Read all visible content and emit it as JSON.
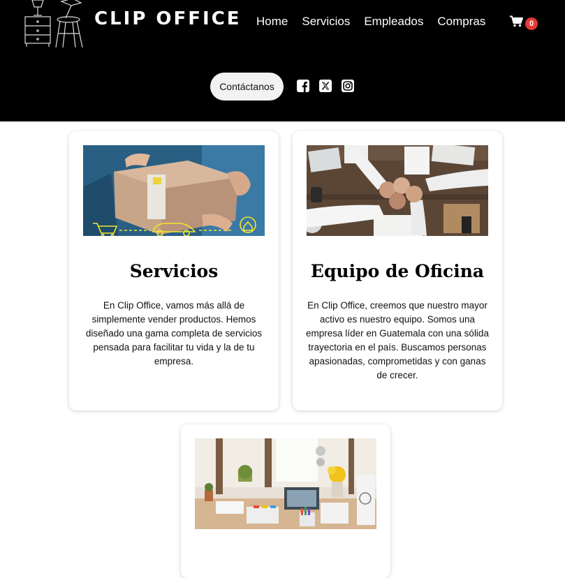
{
  "brand": {
    "name": "CLIP OFFICE"
  },
  "nav": {
    "items": [
      {
        "label": "Home"
      },
      {
        "label": "Servicios"
      },
      {
        "label": "Empleados"
      },
      {
        "label": "Compras"
      }
    ],
    "cart_count": "0"
  },
  "contact": {
    "label": "Contáctanos"
  },
  "social": [
    "facebook-icon",
    "x-icon",
    "instagram-icon"
  ],
  "cards": [
    {
      "title": "Servicios",
      "text": "En Clip Office, vamos más allá de simplemente vender productos. Hemos diseñado una gama completa de servicios pensada para facilitar tu vida y la de tu empresa."
    },
    {
      "title": "Equipo de Oficina",
      "text": "En Clip Office, creemos que nuestro mayor activo es nuestro equipo. Somos una empresa líder en Guatemala con una sólida trayectoria en el país. Buscamos personas apasionadas, comprometidas y con ganas de crecer."
    }
  ],
  "colors": {
    "header_bg": "#000000",
    "badge": "#e53935",
    "button_bg": "#f2f2f2"
  }
}
